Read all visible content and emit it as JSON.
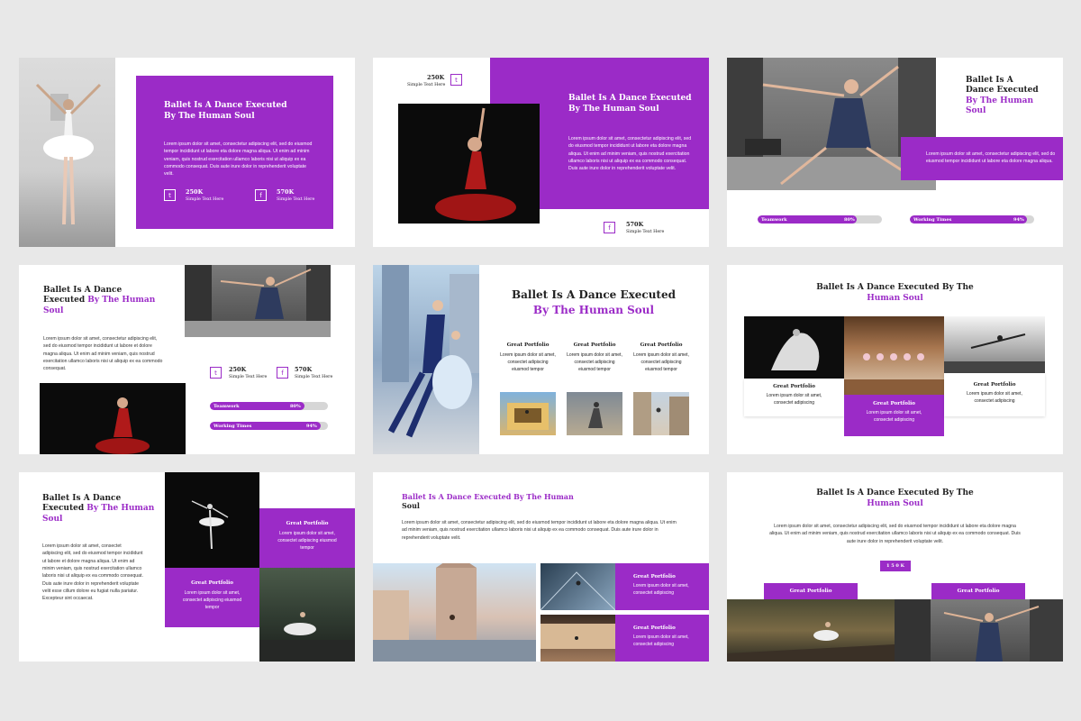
{
  "colors": {
    "accent": "#9b2bc7",
    "background": "#e8e8e8"
  },
  "common": {
    "title_full": "Ballet Is A Dance Executed By The Human Soul",
    "title_a": "Ballet Is A Dance Executed By",
    "title_b": "The Human Soul",
    "lorem_long": "Lorem ipsum dolor sit amet, consectetur adipiscing elit, sed do eiusmod tempor incididunt ut labore eta dolore magna aliqua. Ut enim ad minim veniam, quis nostrud exercitation ullamco laboris nisi ut aliquip ex ea commodo consequat. Duis aute irure dolor in reprehenderit voluptate velit.",
    "lorem_med": "Lorem ipsum dolor sit amet, consectetur adipiscing elit, sed do eiusmod tempor incididunt ut labore et dolore magna aliqua. Ut enim ad minim veniam, quis nostrud exercitation ullamco laboris nisi ut aliquip ex ea commodo consequat.",
    "lorem_short": "Lorem ipsum dolor sit amet, consectetur adipiscing elit, sed do eiusmod tempor incididunt ut labore eta dolore magna aliqua.",
    "portfolio": "Great Portfolio",
    "portfolio_text": "Lorem ipsum dolor sit amet, consectet adipiscing eiusmod tempor",
    "portfolio_text2": "Lorem ipsum dolor sit amet, consectet adipiscing",
    "twitter_value": "250K",
    "facebook_value": "570K",
    "stat_label": "Simple Text Here",
    "teamwork": "Teamwork",
    "teamwork_pct": "80%",
    "teamwork_fill": 0.8,
    "working": "Working Times",
    "working_pct": "94%",
    "working_fill": 0.94,
    "button_150k": "1 5 0 K",
    "twitter_icon": "twitter-icon",
    "facebook_icon": "facebook-icon"
  },
  "slide3": {
    "title_l1": "Ballet Is A",
    "title_l2": "Dance Executed",
    "title_l3": "By The Human",
    "title_l4": "Soul"
  },
  "slide4": {
    "title_l1": "Ballet Is A Dance",
    "title_l2": "Executed",
    "title_l2b": "By The Human",
    "title_l3": "Soul"
  },
  "slide5": {
    "title_l1": "Ballet Is A Dance Executed",
    "title_l2": "By The Human Soul"
  },
  "slide6": {
    "title_l1": "Ballet Is A Dance Executed By The",
    "title_l2": "Human Soul"
  },
  "slide7": {
    "title_l1": "Ballet Is A Dance",
    "title_l2": "Executed",
    "title_l2b": "By The Human",
    "title_l3": "Soul",
    "body": "Lorem ipsum dolor sit amet, consectet adipiscing elit, sed do eiusmod tempor incididunt ut labore et dolore magna aliqua. Ut enim ad minim veniam, quis nostrud exercitation ullamco laboris nisi ut aliquip ex ea commodo consequat. Duis aute irure dolor in reprehenderit voluptate velit esse cillum dolore eu fugiat nulla pariatur. Excepteur sint occaecat."
  },
  "slide8": {
    "title_l1": "Ballet Is A Dance Executed By The Human",
    "title_l2": "Soul"
  },
  "slide9": {
    "title_l1": "Ballet Is A Dance Executed By The",
    "title_l2": "Human Soul"
  }
}
